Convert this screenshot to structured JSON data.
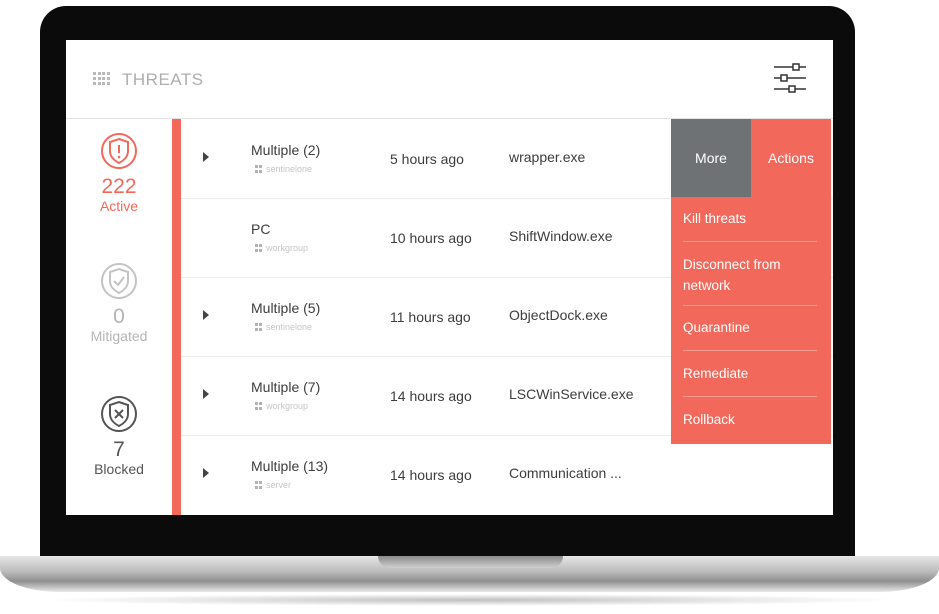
{
  "header": {
    "title": "THREATS",
    "grid_icon": "grid-icon",
    "filter_icon": "sliders-icon"
  },
  "sidebar": {
    "active": {
      "count": "222",
      "label": "Active",
      "icon": "shield-alert-icon",
      "color": "#f2685a"
    },
    "mitigated": {
      "count": "0",
      "label": "Mitigated",
      "icon": "shield-check-icon",
      "color": "#bdbdbd"
    },
    "blocked": {
      "count": "7",
      "label": "Blocked",
      "icon": "shield-x-icon",
      "color": "#555555"
    }
  },
  "rows": [
    {
      "name": "Multiple (2)",
      "group": "sentinelone",
      "time": "5 hours ago",
      "file": "wrapper.exe",
      "expandable": true
    },
    {
      "name": "PC",
      "group": "workgroup",
      "time": "10 hours ago",
      "file": "ShiftWindow.exe",
      "expandable": false
    },
    {
      "name": "Multiple (5)",
      "group": "sentinelone",
      "time": "11 hours ago",
      "file": "ObjectDock.exe",
      "expandable": true
    },
    {
      "name": "Multiple (7)",
      "group": "workgroup",
      "time": "14 hours ago",
      "file": "LSCWinService.exe",
      "expandable": true
    },
    {
      "name": "Multiple (13)",
      "group": "server",
      "time": "14 hours ago",
      "file": "Communication ...",
      "expandable": true
    }
  ],
  "actions": {
    "more_label": "More",
    "actions_label": "Actions",
    "items": [
      "Kill threats",
      "Disconnect from network",
      "Quarantine",
      "Remediate",
      "Rollback"
    ]
  },
  "colors": {
    "accent": "#f2685a",
    "more_bg": "#6f7275"
  }
}
